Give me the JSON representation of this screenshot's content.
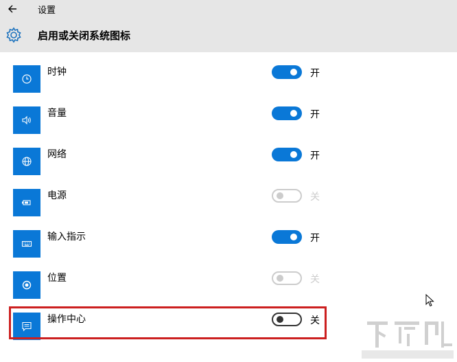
{
  "window": {
    "title": "设置",
    "back_icon": "arrow-left-icon"
  },
  "header": {
    "icon": "gear-icon",
    "title": "启用或关闭系统图标"
  },
  "colors": {
    "accent": "#0a78d7",
    "titlebar_bg": "#e6e6e6",
    "highlight": "#cc1f1f",
    "disabled": "#cccccc"
  },
  "items": [
    {
      "label": "时钟",
      "icon": "clock-icon",
      "state": "开",
      "on": true,
      "disabled": false
    },
    {
      "label": "音量",
      "icon": "volume-icon",
      "state": "开",
      "on": true,
      "disabled": false
    },
    {
      "label": "网络",
      "icon": "globe-icon",
      "state": "开",
      "on": true,
      "disabled": false
    },
    {
      "label": "电源",
      "icon": "battery-icon",
      "state": "关",
      "on": false,
      "disabled": true
    },
    {
      "label": "输入指示",
      "icon": "keyboard-icon",
      "state": "开",
      "on": true,
      "disabled": false
    },
    {
      "label": "位置",
      "icon": "location-icon",
      "state": "关",
      "on": false,
      "disabled": true
    },
    {
      "label": "操作中心",
      "icon": "action-center-icon",
      "state": "关",
      "on": false,
      "disabled": false,
      "highlighted": true
    }
  ]
}
